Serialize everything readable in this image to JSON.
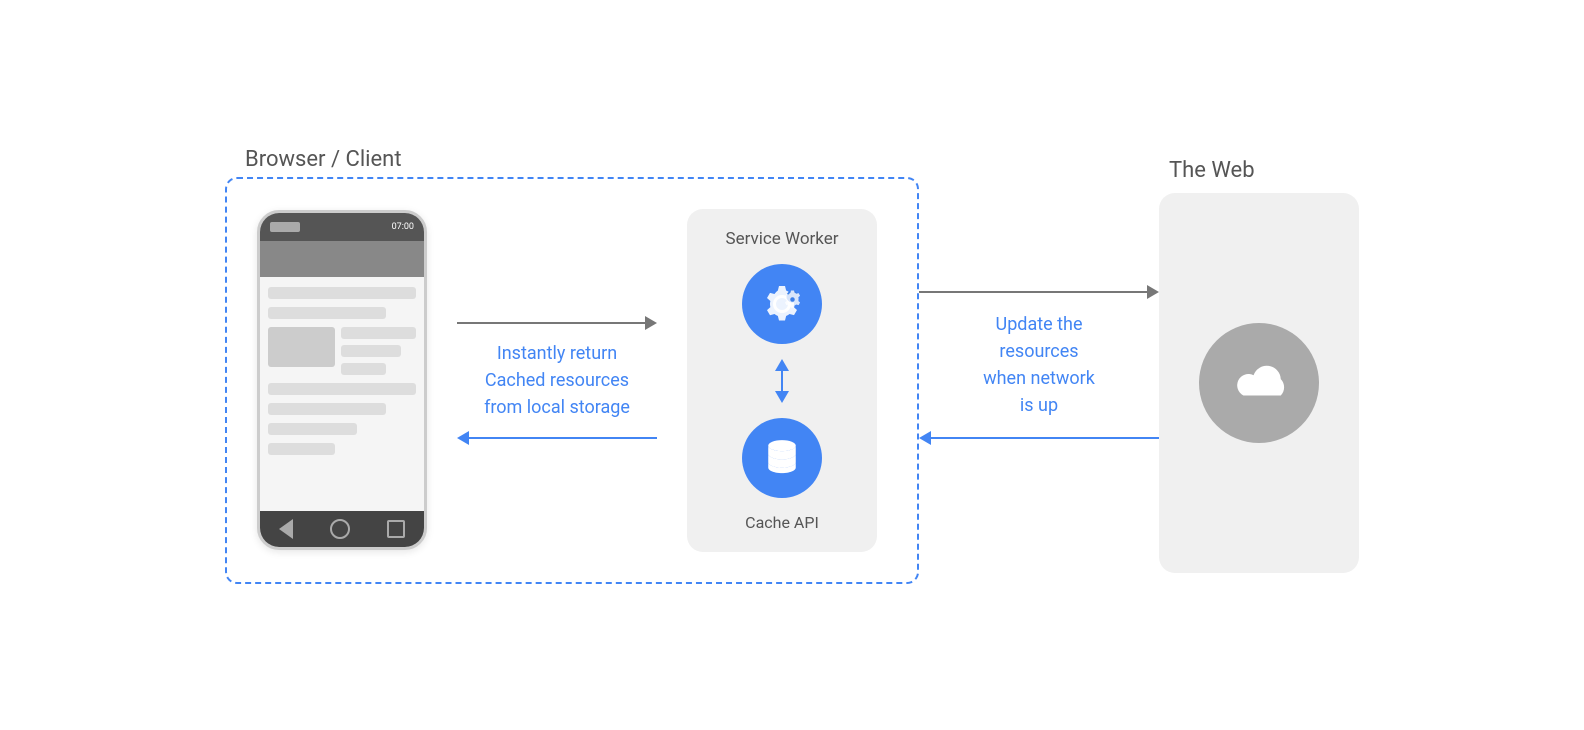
{
  "labels": {
    "browser_client": "Browser / Client",
    "the_web": "The Web",
    "service_worker": "Service Worker",
    "cache_api": "Cache API",
    "instantly_return": "Instantly return",
    "cached_resources": "Cached resources",
    "from_local_storage": "from local storage",
    "update_the": "Update the",
    "resources": "resources",
    "when_network": "when network",
    "is_up": "is up"
  },
  "colors": {
    "blue": "#4285f4",
    "gray_text": "#555",
    "light_bg": "#f0f0f0",
    "dashed_border": "#4285f4",
    "arrow_gray": "#777",
    "cloud_gray": "#aaa",
    "phone_dark": "#555",
    "phone_bar": "#888"
  }
}
